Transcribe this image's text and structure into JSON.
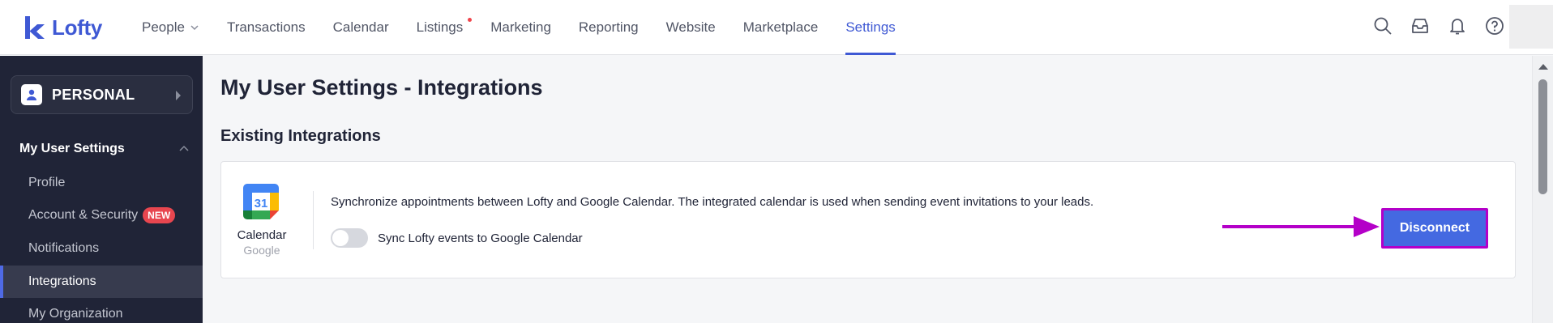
{
  "app": {
    "brand": "Lofty",
    "brand_color": "#3f59d4"
  },
  "nav": {
    "items": [
      {
        "label": "People",
        "has_dropdown": true
      },
      {
        "label": "Transactions"
      },
      {
        "label": "Calendar"
      },
      {
        "label": "Listings",
        "has_notification_dot": true
      },
      {
        "label": "Marketing"
      },
      {
        "label": "Reporting"
      },
      {
        "label": "Website"
      },
      {
        "label": "Marketplace"
      },
      {
        "label": "Settings",
        "active": true
      }
    ],
    "icons": [
      "search-icon",
      "inbox-icon",
      "bell-icon",
      "help-icon"
    ]
  },
  "sidebar": {
    "account_label": "PERSONAL",
    "section_title": "My User Settings",
    "items": [
      {
        "label": "Profile"
      },
      {
        "label": "Account & Security",
        "badge": "NEW"
      },
      {
        "label": "Notifications"
      },
      {
        "label": "Integrations",
        "active": true
      },
      {
        "label": "My Organization"
      }
    ]
  },
  "main": {
    "title": "My User Settings - Integrations",
    "section_title": "Existing Integrations",
    "integration": {
      "icon": "google-calendar-icon",
      "icon_day": "31",
      "name": "Calendar",
      "provider": "Google",
      "description": "Synchronize appointments between Lofty and Google Calendar. The integrated calendar is used when sending event invitations to your leads.",
      "toggle_label": "Sync Lofty events to Google Calendar",
      "toggle_on": false,
      "action_label": "Disconnect"
    }
  },
  "annotation": {
    "arrow_color": "#b400c8",
    "highlight_color": "#b400c8"
  }
}
